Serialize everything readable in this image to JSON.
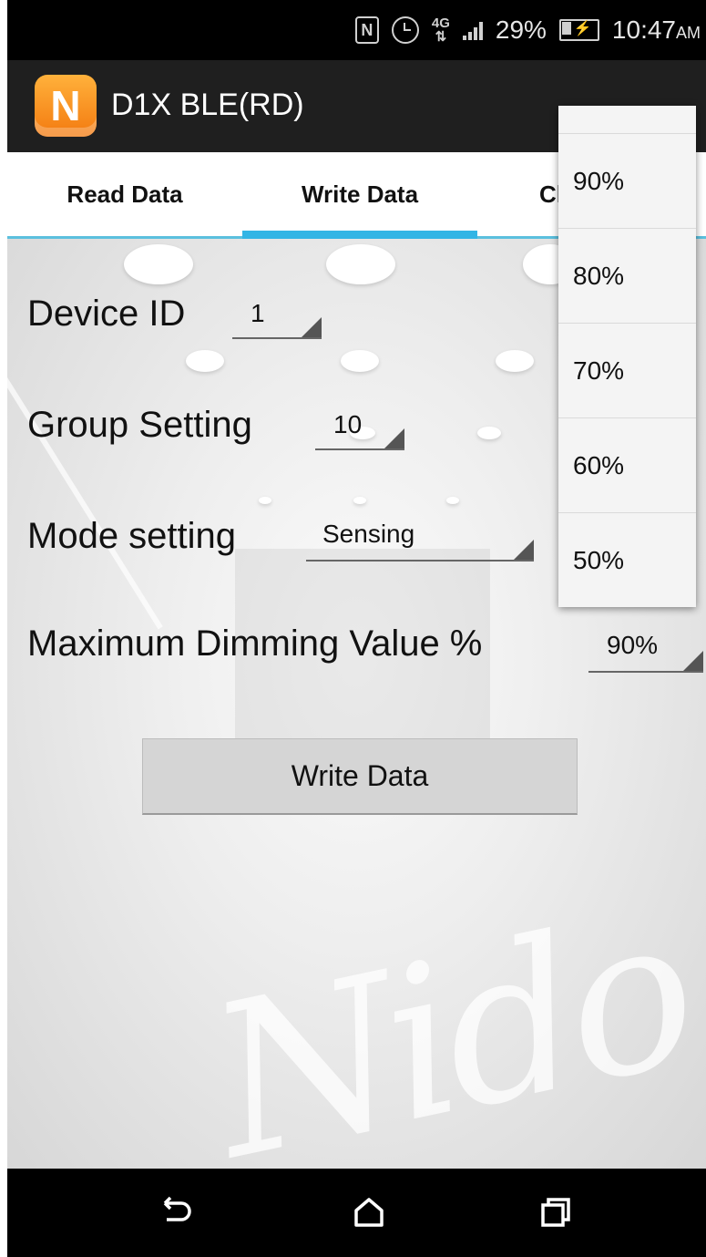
{
  "status_bar": {
    "network_label": "4G",
    "battery_percent": "29%",
    "time": "10:47",
    "time_suffix": "AM",
    "icons": [
      "nfc-icon",
      "alarm-icon",
      "lte-icon",
      "signal-icon",
      "battery-icon"
    ]
  },
  "action_bar": {
    "logo_letter": "N",
    "title": "D1X BLE(RD)"
  },
  "tabs": [
    {
      "label": "Read Data",
      "selected": false
    },
    {
      "label": "Write Data",
      "selected": true
    },
    {
      "label": "Cl",
      "selected": false
    }
  ],
  "form": {
    "device_id": {
      "label": "Device ID",
      "value": "1"
    },
    "group_setting": {
      "label": "Group Setting",
      "value": "10"
    },
    "mode_setting": {
      "label": "Mode setting",
      "value": "Sensing"
    },
    "max_dimming": {
      "label": "Maximum Dimming Value %",
      "value": "90%"
    },
    "write_button": "Write Data"
  },
  "dropdown": {
    "options": [
      "90%",
      "80%",
      "70%",
      "60%",
      "50%"
    ]
  },
  "background": {
    "watermark_text": "Nido"
  },
  "nav_bar": {
    "icons": [
      "back-icon",
      "home-icon",
      "recents-icon"
    ]
  },
  "colors": {
    "accent": "#33b5e5",
    "action_bar": "#1f1f1f",
    "logo": "#f37a10"
  }
}
